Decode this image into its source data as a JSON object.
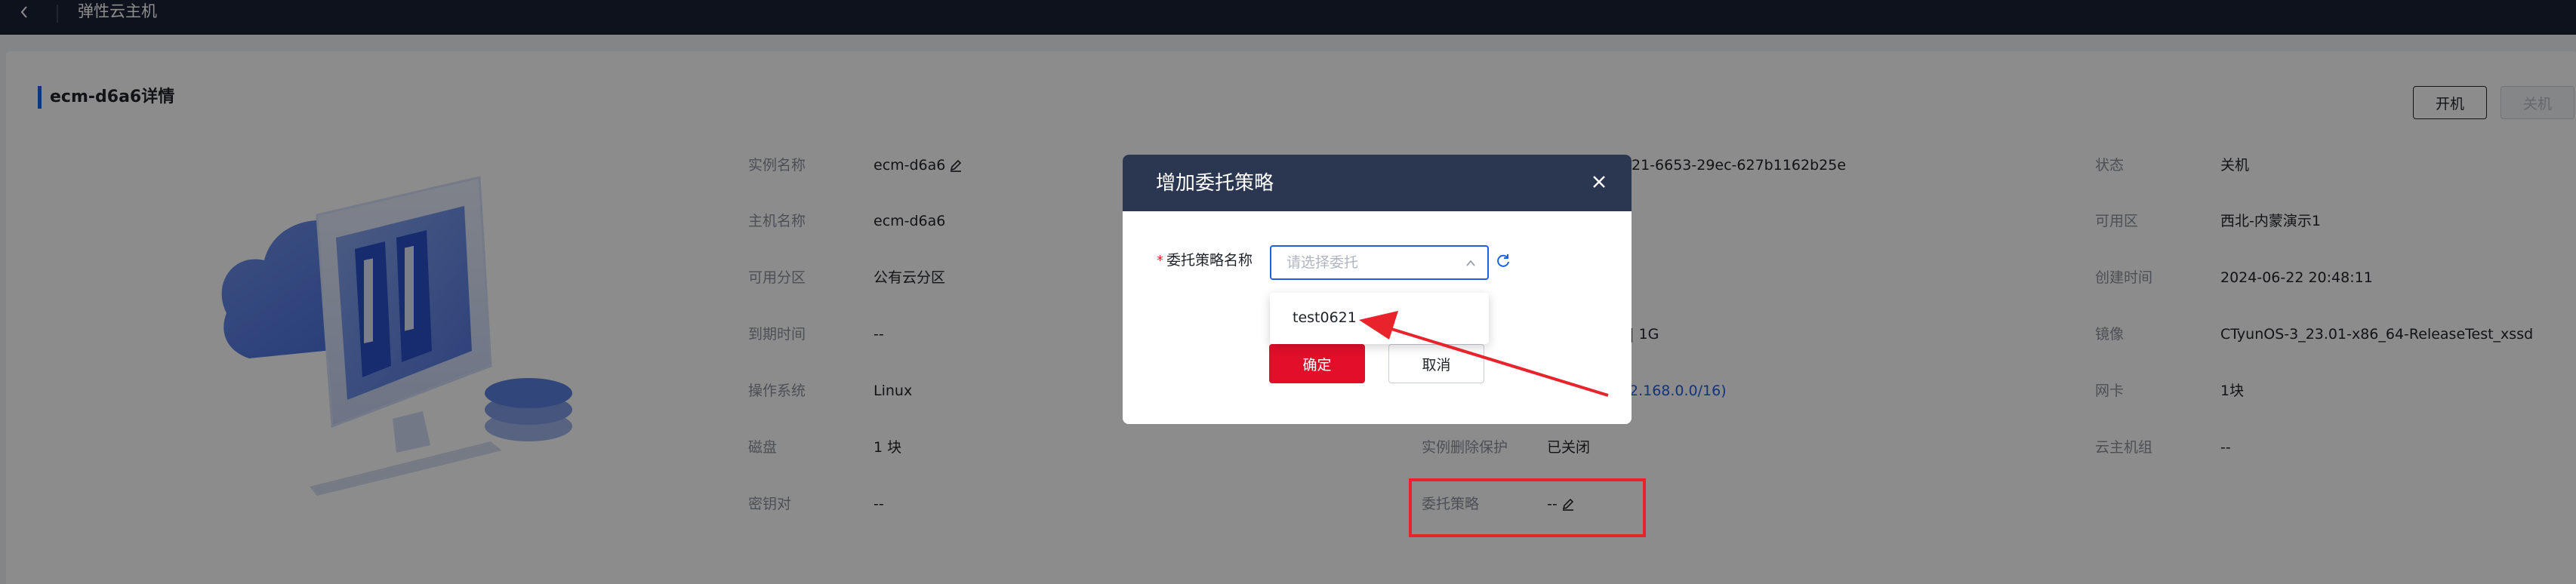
{
  "topbar": {
    "title": "弹性云主机"
  },
  "detail": {
    "title": "ecm-d6a6详情",
    "buttons": {
      "start": "开机",
      "stop": "关机"
    },
    "col1": [
      {
        "label": "实例名称",
        "value": "ecm-d6a6"
      },
      {
        "label": "主机名称",
        "value": "ecm-d6a6"
      },
      {
        "label": "可用分区",
        "value": "公有云分区"
      },
      {
        "label": "到期时间",
        "value": "--"
      },
      {
        "label": "操作系统",
        "value": "Linux"
      },
      {
        "label": "磁盘",
        "value": "1 块"
      },
      {
        "label": "密钥对",
        "value": "--"
      }
    ],
    "col2_partial": {
      "id_value": "21-6653-29ec-627b1162b25e",
      "spec_value": "核 | 1G",
      "vpc_value": "2.168.0.0/16)"
    },
    "col2": [
      {
        "label": "实例删除保护",
        "value": "已关闭"
      },
      {
        "label": "委托策略",
        "value": "--"
      }
    ],
    "col3": [
      {
        "label": "状态",
        "value": "关机"
      },
      {
        "label": "可用区",
        "value": "西北-内蒙演示1"
      },
      {
        "label": "创建时间",
        "value": "2024-06-22 20:48:11"
      },
      {
        "label": "镜像",
        "value": "CTyunOS-3_23.01-x86_64-ReleaseTest_xssd"
      },
      {
        "label": "网卡",
        "value": "1块"
      },
      {
        "label": "云主机组",
        "value": "--"
      }
    ]
  },
  "modal": {
    "title": "增加委托策略",
    "form_label": "委托策略名称",
    "required_mark": "*",
    "select_placeholder": "请选择委托",
    "options": [
      "test0621"
    ],
    "confirm": "确定",
    "cancel": "取消"
  },
  "colors": {
    "topbar": "#1a2236",
    "accent": "#1f5fe0",
    "modal_header": "#2b3651",
    "confirm": "#e20f2a",
    "annotation": "#e8232c"
  }
}
